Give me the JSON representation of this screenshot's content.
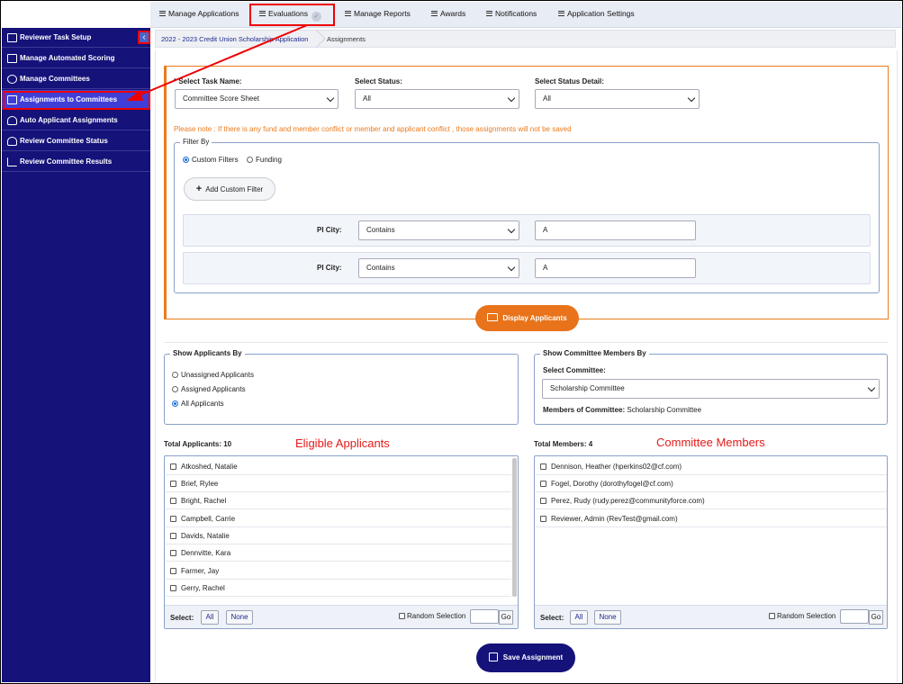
{
  "topnav": {
    "items": [
      "Manage Applications",
      "Evaluations",
      "Manage Reports",
      "Awards",
      "Notifications",
      "Application Settings"
    ],
    "evaluations_check": "✓"
  },
  "sidebar": {
    "collapse_glyph": "‹",
    "items": [
      {
        "label": "Reviewer Task Setup",
        "icon": "gear-doc-icon"
      },
      {
        "label": "Manage Automated Scoring",
        "icon": "grid-icon"
      },
      {
        "label": "Manage Committees",
        "icon": "group-icon"
      },
      {
        "label": "Assignments to Committees",
        "icon": "clipboard-icon"
      },
      {
        "label": "Auto Applicant Assignments",
        "icon": "user-icon"
      },
      {
        "label": "Review Committee Status",
        "icon": "user-status-icon"
      },
      {
        "label": "Review Committee Results",
        "icon": "chart-icon"
      }
    ]
  },
  "breadcrumb": {
    "parent": "2022 - 2023 Credit Union Scholarship Application",
    "current": "Assignments"
  },
  "filters": {
    "task_name_label": "* Select Task Name:",
    "task_name_value": "Committee Score Sheet",
    "status_label": "Select Status:",
    "status_value": "All",
    "status_detail_label": "Select Status Detail:",
    "status_detail_value": "All",
    "note": "Please note : If there is any fund and member conflict or member and applicant conflict , those assignments will not be saved",
    "filter_by_legend": "Filter By",
    "radio_custom": "Custom Filters",
    "radio_funding": "Funding",
    "add_custom_filter": "Add Custom Filter",
    "rows": [
      {
        "label": "PI City:",
        "operator": "Contains",
        "value": "A"
      },
      {
        "label": "PI City:",
        "operator": "Contains",
        "value": "A"
      }
    ],
    "display_button": "Display Applicants"
  },
  "show_applicants": {
    "legend": "Show Applicants By",
    "options": [
      "Unassigned Applicants",
      "Assigned Applicants",
      "All Applicants"
    ]
  },
  "show_members": {
    "legend": "Show Committee Members By",
    "select_label": "Select Committee:",
    "select_value": "Scholarship Committee",
    "members_label": "Members of Committee:",
    "members_value": "Scholarship Committee"
  },
  "applicants": {
    "annotation": "Eligible Applicants",
    "total": "Total Applicants: 10",
    "items": [
      "Atkoshed, Natalie",
      "Brief, Rylee",
      "Bright, Rachel",
      "Campbell, Carrie",
      "Davids, Natalie",
      "Dennvitte, Kara",
      "Farmer, Jay",
      "Gerry, Rachel"
    ]
  },
  "members": {
    "annotation": "Committee Members",
    "total": "Total Members: 4",
    "items": [
      "Dennison, Heather (hperkins02@cf.com)",
      "Fogel, Dorothy (dorothyfogel@cf.com)",
      "Perez, Rudy (rudy.perez@communityforce.com)",
      "Reviewer, Admin (RevTest@gmail.com)"
    ]
  },
  "list_footer": {
    "select_label": "Select:",
    "all": "All",
    "none": "None",
    "random": "Random Selection",
    "go": "Go"
  },
  "save_button": "Save Assignment",
  "colors": {
    "sidebar": "#15127a",
    "accent_orange": "#e8731a",
    "annotation_red": "#e41a1a",
    "active_item": "#3f3fd8"
  }
}
